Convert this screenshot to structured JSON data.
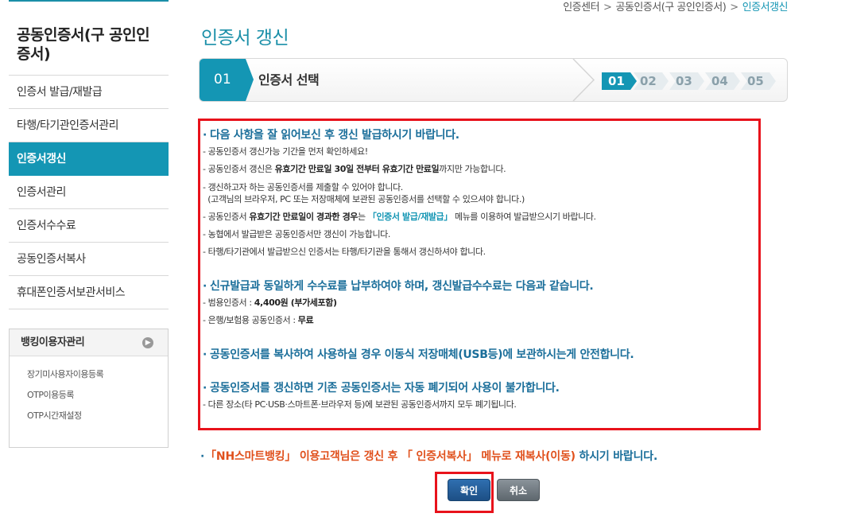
{
  "breadcrumb": [
    "인증센터",
    "공동인증서(구 공인인증서)",
    "인증서갱신"
  ],
  "breadcrumb_sep": ">",
  "sidebar": {
    "title": "공동인증서(구 공인인증서)",
    "items": [
      {
        "label": "인증서 발급/재발급",
        "active": false
      },
      {
        "label": "타행/타기관인증서관리",
        "active": false
      },
      {
        "label": "인증서갱신",
        "active": true
      },
      {
        "label": "인증서관리",
        "active": false
      },
      {
        "label": "인증서수수료",
        "active": false
      },
      {
        "label": "공동인증서복사",
        "active": false
      },
      {
        "label": "휴대폰인증서보관서비스",
        "active": false
      }
    ],
    "banking": {
      "title": "뱅킹이용자관리",
      "items": [
        "장기미사용자이용등록",
        "OTP이용등록",
        "OTP시간재설정"
      ]
    }
  },
  "page_title": "인증서 갱신",
  "stepbar": {
    "current_num": "01",
    "current_label": "인증서 선택",
    "steps": [
      "01",
      "02",
      "03",
      "04",
      "05"
    ],
    "active_step": "01"
  },
  "notice": {
    "s1_title": "다음 사항을 잘 읽어보신 후 갱신 발급하시기 바랍니다.",
    "s1_l1": "공동인증서 갱신가능 기간을 먼저 확인하세요!",
    "s1_l2_a": "공동인증서 갱신은 ",
    "s1_l2_b": "유효기간 만료일 30일 전부터 유효기간 만료일",
    "s1_l2_c": "까지만 가능합니다.",
    "s1_l3_a": "갱신하고자 하는 공동인증서를 제출할 수 있어야 합니다.",
    "s1_l3_b": "(고객님의 브라우저, PC 또는 저장매체에 보관된 공동인증서를 선택할 수 있으셔야 합니다.)",
    "s1_l4_a": "공동인증서 ",
    "s1_l4_b": "유효기간 만료일이 경과한 경우",
    "s1_l4_c": "는 ",
    "s1_l4_d": "「인증서 발급/재발급」",
    "s1_l4_e": "메뉴를 이용하여 발급받으시기 바랍니다.",
    "s1_l5": "농협에서 발급받은 공동인증서만 갱신이 가능합니다.",
    "s1_l6": "타행/타기관에서 발급받으신 인증서는 타행/타기관을 통해서 갱신하셔야 합니다.",
    "s2_title": "신규발급과 동일하게 수수료를 납부하여야 하며, 갱신발급수수료는 다음과 같습니다.",
    "s2_l1_a": "범용인증서 : ",
    "s2_l1_b": "4,400원 (부가세포함)",
    "s2_l2_a": "은행/보험용 공동인증서 : ",
    "s2_l2_b": "무료",
    "s3_title": "공동인증서를 복사하여 사용하실 경우 이동식 저장매체(USB등)에 보관하시는게 안전합니다.",
    "s4_title": "공동인증서를 갱신하면 기존 공동인증서는 자동 폐기되어 사용이 불가합니다.",
    "s4_l1": "다른 장소(타 PC·USB·스마트폰·브라우저 등)에 보관된 공동인증서까지 모두 폐기됩니다."
  },
  "bottom_note": {
    "red": "「NH스마트뱅킹」 이용고객님은 갱신 후 「 인증서복사」 메뉴로 재복사(이동)",
    "blue": " 하시기 바랍니다."
  },
  "buttons": {
    "ok": "확인",
    "cancel": "취소"
  },
  "colors": {
    "accent": "#1496b4",
    "highlight_border": "#e8121b",
    "heading_blue": "#1a6e9a",
    "note_red": "#e0501c"
  }
}
